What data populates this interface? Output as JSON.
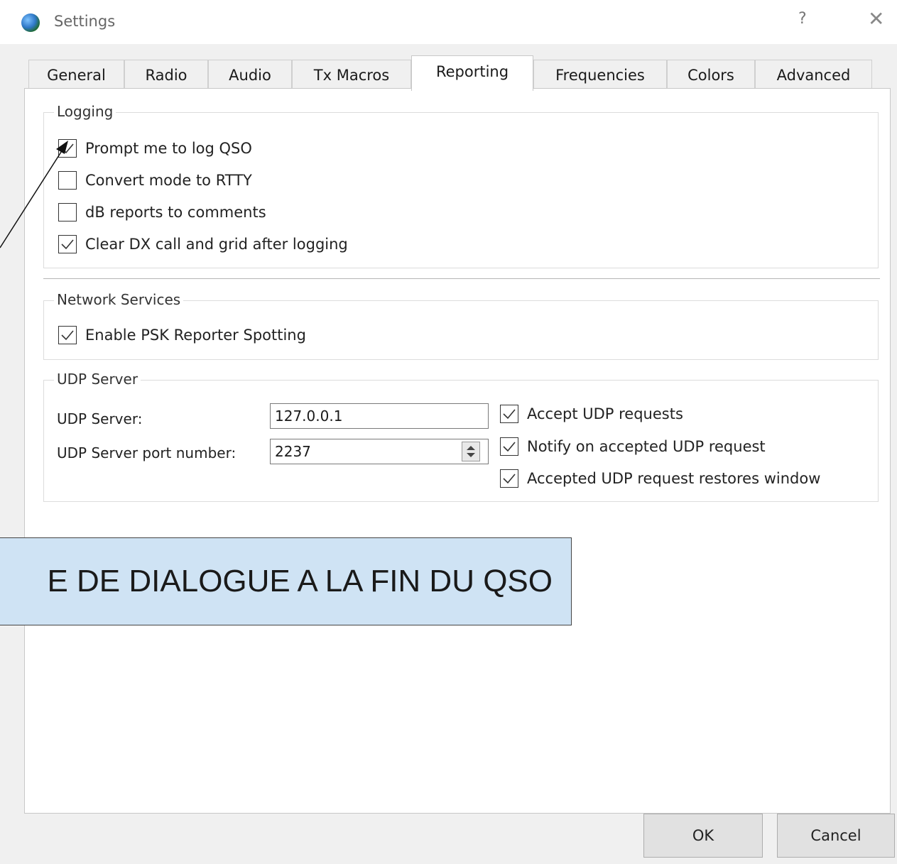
{
  "window": {
    "title": "Settings",
    "help": "?",
    "close": "✕"
  },
  "tabs": [
    {
      "label": "General"
    },
    {
      "label": "Radio"
    },
    {
      "label": "Audio"
    },
    {
      "label": "Tx Macros"
    },
    {
      "label": "Reporting",
      "active": true
    },
    {
      "label": "Frequencies"
    },
    {
      "label": "Colors"
    },
    {
      "label": "Advanced"
    }
  ],
  "logging": {
    "title": "Logging",
    "items": [
      {
        "label": "Prompt me to log QSO",
        "checked": true
      },
      {
        "label": "Convert mode to RTTY",
        "checked": false
      },
      {
        "label": "dB reports to comments",
        "checked": false
      },
      {
        "label": "Clear DX call and grid after logging",
        "checked": true
      }
    ]
  },
  "network": {
    "title": "Network Services",
    "items": [
      {
        "label": "Enable PSK Reporter Spotting",
        "checked": true
      }
    ]
  },
  "udp": {
    "title": "UDP Server",
    "server_label": "UDP Server:",
    "server_value": "127.0.0.1",
    "port_label": "UDP Server port number:",
    "port_value": "2237",
    "options": [
      {
        "label": "Accept UDP requests",
        "checked": true
      },
      {
        "label": "Notify on accepted UDP request",
        "checked": true
      },
      {
        "label": "Accepted UDP request restores window",
        "checked": true
      }
    ]
  },
  "annotation": {
    "text": "E DE DIALOGUE A LA FIN DU QSO"
  },
  "buttons": {
    "ok": "OK",
    "cancel": "Cancel"
  }
}
